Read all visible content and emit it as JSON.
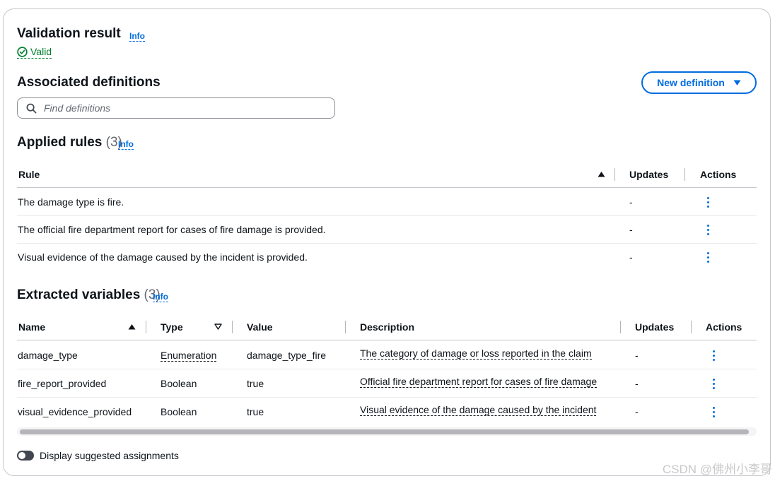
{
  "validation": {
    "title": "Validation result",
    "info": "Info",
    "status": "Valid"
  },
  "definitions": {
    "title": "Associated definitions",
    "new_button": "New definition",
    "search_placeholder": "Find definitions"
  },
  "rules": {
    "title": "Applied rules",
    "count": "(3)",
    "info": "Info",
    "columns": {
      "rule": "Rule",
      "updates": "Updates",
      "actions": "Actions"
    },
    "rows": [
      {
        "rule": "The damage type is fire.",
        "updates": "-"
      },
      {
        "rule": "The official fire department report for cases of fire damage is provided.",
        "updates": "-"
      },
      {
        "rule": "Visual evidence of the damage caused by the incident is provided.",
        "updates": "-"
      }
    ]
  },
  "variables": {
    "title": "Extracted variables",
    "count": "(3)",
    "info": "Info",
    "columns": {
      "name": "Name",
      "type": "Type",
      "value": "Value",
      "description": "Description",
      "updates": "Updates",
      "actions": "Actions"
    },
    "rows": [
      {
        "name": "damage_type",
        "type": "Enumeration",
        "value": "damage_type_fire",
        "description": "The category of damage or loss reported in the claim",
        "updates": "-"
      },
      {
        "name": "fire_report_provided",
        "type": "Boolean",
        "value": "true",
        "description": "Official fire department report for cases of fire damage",
        "updates": "-"
      },
      {
        "name": "visual_evidence_provided",
        "type": "Boolean",
        "value": "true",
        "description": "Visual evidence of the damage caused by the incident",
        "updates": "-"
      }
    ]
  },
  "toggle": {
    "label": "Display suggested assignments"
  },
  "watermark": "CSDN @佛州小李哥",
  "colors": {
    "link": "#006ce0",
    "success": "#00802f",
    "text": "#0f141a"
  }
}
